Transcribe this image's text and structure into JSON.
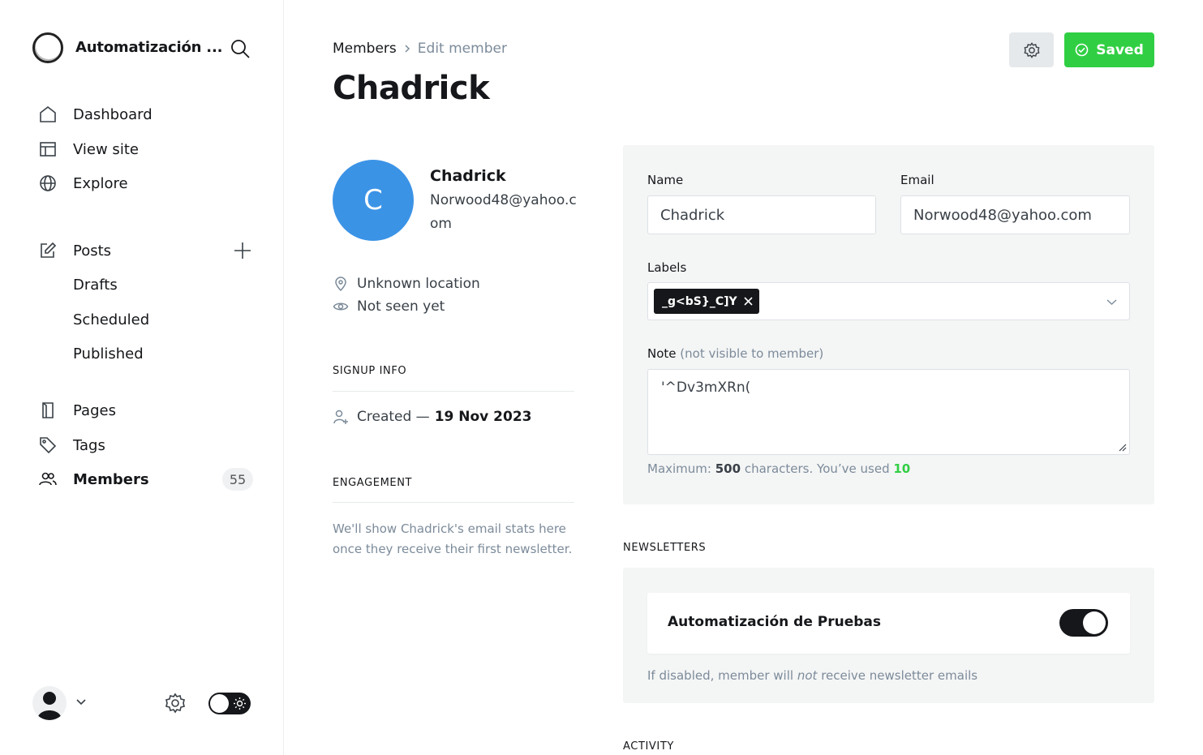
{
  "sidebar": {
    "site_title": "Automatización ...",
    "nav": {
      "dashboard": "Dashboard",
      "view_site": "View site",
      "explore": "Explore",
      "posts": "Posts",
      "drafts": "Drafts",
      "scheduled": "Scheduled",
      "published": "Published",
      "pages": "Pages",
      "tags": "Tags",
      "members": "Members",
      "members_count": "55"
    }
  },
  "header": {
    "breadcrumb_parent": "Members",
    "breadcrumb_current": "Edit member",
    "title": "Chadrick",
    "save_label": "Saved"
  },
  "member": {
    "initial": "C",
    "name": "Chadrick",
    "email": "Norwood48@yahoo.com",
    "location": "Unknown location",
    "seen": "Not seen yet",
    "signup_heading": "SIGNUP INFO",
    "created_label": "Created —",
    "created_date": "19 Nov 2023",
    "engagement_heading": "ENGAGEMENT",
    "engagement_text": "We'll show Chadrick's email stats here once they receive their first newsletter."
  },
  "form": {
    "name_label": "Name",
    "name_value": "Chadrick",
    "email_label": "Email",
    "email_value": "Norwood48@yahoo.com",
    "labels_label": "Labels",
    "labels": [
      "_g<bS}_C]Y"
    ],
    "note_label": "Note",
    "note_sublabel": "(not visible to member)",
    "note_value": "'^Dv3mXRn(",
    "hint_prefix": "Maximum:",
    "hint_max": "500",
    "hint_middle": "characters. You’ve used",
    "hint_used": "10"
  },
  "newsletters": {
    "heading": "NEWSLETTERS",
    "name": "Automatización de Pruebas",
    "subscribed": true,
    "hint_before": "If disabled, member will",
    "hint_not": "not",
    "hint_after": "receive newsletter emails"
  },
  "activity": {
    "heading": "ACTIVITY"
  },
  "colors": {
    "accent_green": "#30cf43",
    "avatar_blue": "#3b93e6"
  }
}
